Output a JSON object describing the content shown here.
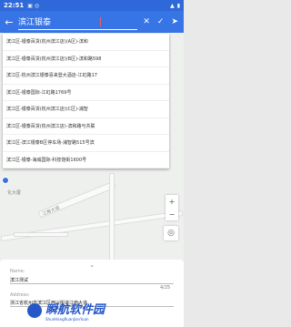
{
  "status_bar": {
    "time": "22:51",
    "right_icons": [
      "signal-icon",
      "battery-icon"
    ]
  },
  "toolbar": {
    "search_value": "滨江银泰",
    "icons": [
      "back-arrow-icon",
      "close-icon",
      "check-icon",
      "send-icon"
    ]
  },
  "suggestions": [
    "滨江区-银泰百货(杭州滨江店)(A区)-滨和",
    "滨江区-银泰百货(杭州滨江店)(B区)-滨和路598",
    "滨江区-杭州滨江银泰喜来登大酒店-江虹路17",
    "滨江区-银泰国际-江虹路1769号",
    "滨江区-银泰百货(杭州滨江店)(C区)-浦智",
    "滨江区-银泰百货(杭州滨江店)-滨和路与共联",
    "滨江区-滨江银泰B区停车场-浦智路515号滨",
    "滨江区-银泰-海威国际-科技馆街1600号"
  ],
  "map": {
    "labels": [
      "江南大道",
      "化大厦"
    ]
  },
  "sheet": {
    "name_label": "Name:",
    "name_value": "滨江测试",
    "name_counter": "4/25",
    "address_label": "Address:",
    "address_value": "浙江省杭州市滨江区西兴街道江南大道"
  },
  "watermark": {
    "cn": "瞬航软件园",
    "en": "ShunHangRuanJianYuan"
  }
}
